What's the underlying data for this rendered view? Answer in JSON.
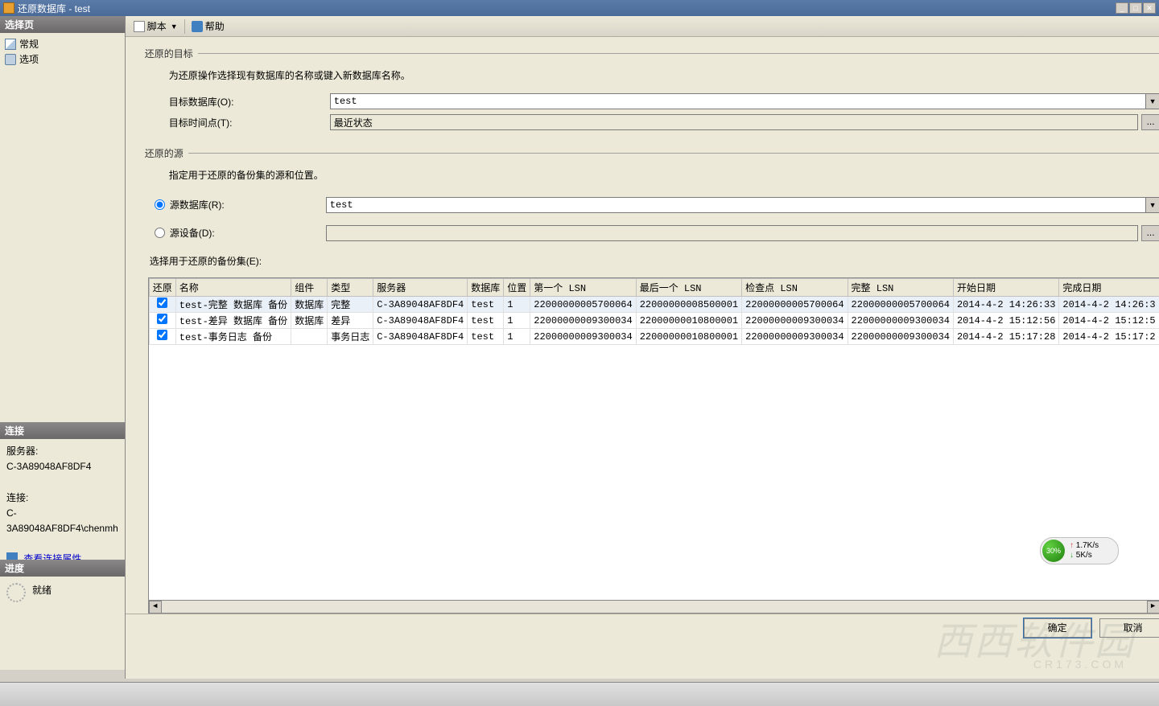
{
  "window": {
    "title": "还原数据库 - test"
  },
  "sidebar": {
    "select_header": "选择页",
    "items": [
      {
        "label": "常规"
      },
      {
        "label": "选项"
      }
    ],
    "conn_header": "连接",
    "server_label": "服务器:",
    "server_value": "C-3A89048AF8DF4",
    "conn_label": "连接:",
    "conn_value": "C-3A89048AF8DF4\\chenmh",
    "view_props": "查看连接属性",
    "progress_header": "进度",
    "progress_status": "就绪"
  },
  "toolbar": {
    "script": "脚本",
    "help": "帮助"
  },
  "form": {
    "target_legend": "还原的目标",
    "target_desc": "为还原操作选择现有数据库的名称或键入新数据库名称。",
    "target_db_label": "目标数据库(O):",
    "target_db_value": "test",
    "target_time_label": "目标时间点(T):",
    "target_time_value": "最近状态",
    "source_legend": "还原的源",
    "source_desc": "指定用于还原的备份集的源和位置。",
    "source_db_label": "源数据库(R):",
    "source_db_value": "test",
    "source_dev_label": "源设备(D):",
    "sets_label": "选择用于还原的备份集(E):"
  },
  "grid": {
    "headers": {
      "restore": "还原",
      "name": "名称",
      "component": "组件",
      "type": "类型",
      "server": "服务器",
      "database": "数据库",
      "position": "位置",
      "first_lsn": "第一个 LSN",
      "last_lsn": "最后一个 LSN",
      "checkpoint_lsn": "检查点 LSN",
      "full_lsn": "完整 LSN",
      "start_date": "开始日期",
      "finish_date": "完成日期"
    },
    "rows": [
      {
        "name": "test-完整 数据库 备份",
        "component": "数据库",
        "type": "完整",
        "server": "C-3A89048AF8DF4",
        "database": "test",
        "position": "1",
        "first_lsn": "22000000005700064",
        "last_lsn": "22000000008500001",
        "checkpoint_lsn": "22000000005700064",
        "full_lsn": "22000000005700064",
        "start": "2014-4-2 14:26:33",
        "finish": "2014-4-2 14:26:3"
      },
      {
        "name": "test-差异 数据库 备份",
        "component": "数据库",
        "type": "差异",
        "server": "C-3A89048AF8DF4",
        "database": "test",
        "position": "1",
        "first_lsn": "22000000009300034",
        "last_lsn": "22000000010800001",
        "checkpoint_lsn": "22000000009300034",
        "full_lsn": "22000000009300034",
        "start": "2014-4-2 15:12:56",
        "finish": "2014-4-2 15:12:5"
      },
      {
        "name": "test-事务日志  备份",
        "component": "",
        "type": "事务日志",
        "server": "C-3A89048AF8DF4",
        "database": "test",
        "position": "1",
        "first_lsn": "22000000009300034",
        "last_lsn": "22000000010800001",
        "checkpoint_lsn": "22000000009300034",
        "full_lsn": "22000000009300034",
        "start": "2014-4-2 15:17:28",
        "finish": "2014-4-2 15:17:2"
      }
    ]
  },
  "footer": {
    "ok": "确定",
    "cancel": "取消"
  },
  "net": {
    "percent": "30%",
    "up": "1.7K/s",
    "down": "5K/s"
  },
  "watermark": {
    "main": "西西软件园",
    "sub": "CR173.COM"
  }
}
